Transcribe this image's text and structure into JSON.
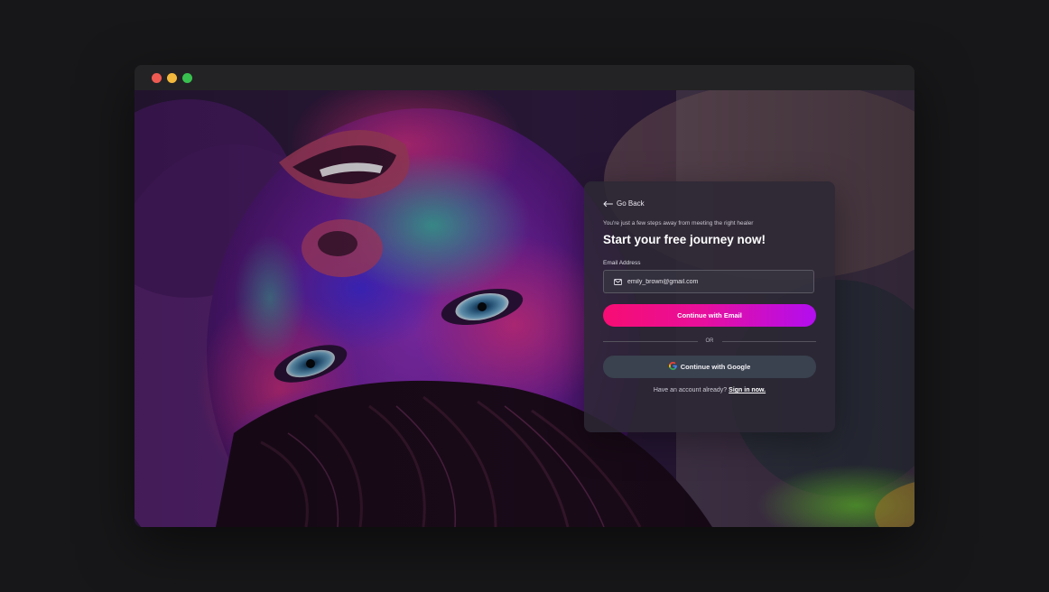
{
  "window": {
    "controls": [
      "close",
      "minimize",
      "maximize"
    ]
  },
  "card": {
    "go_back_label": "Go Back",
    "subtitle": "You're just a few steps away from meeting the right healer",
    "heading": "Start your free journey now!",
    "email_label": "Email Address",
    "email_value": "emily_brown@gmail.com",
    "continue_email_label": "Continue with Email",
    "divider_text": "OR",
    "continue_google_label": "Continue with Google",
    "signin_prompt": "Have an account already?",
    "signin_link": "Sign in now."
  },
  "colors": {
    "accent_gradient_start": "#f70d73",
    "accent_gradient_end": "#b20ef0",
    "google_button": "#3a414f",
    "card_background": "#2c2834"
  },
  "icons": {
    "back": "arrow-left-icon",
    "email": "mail-icon",
    "google": "google-logo-icon"
  },
  "background_image": "colorful-powder-face-photo"
}
